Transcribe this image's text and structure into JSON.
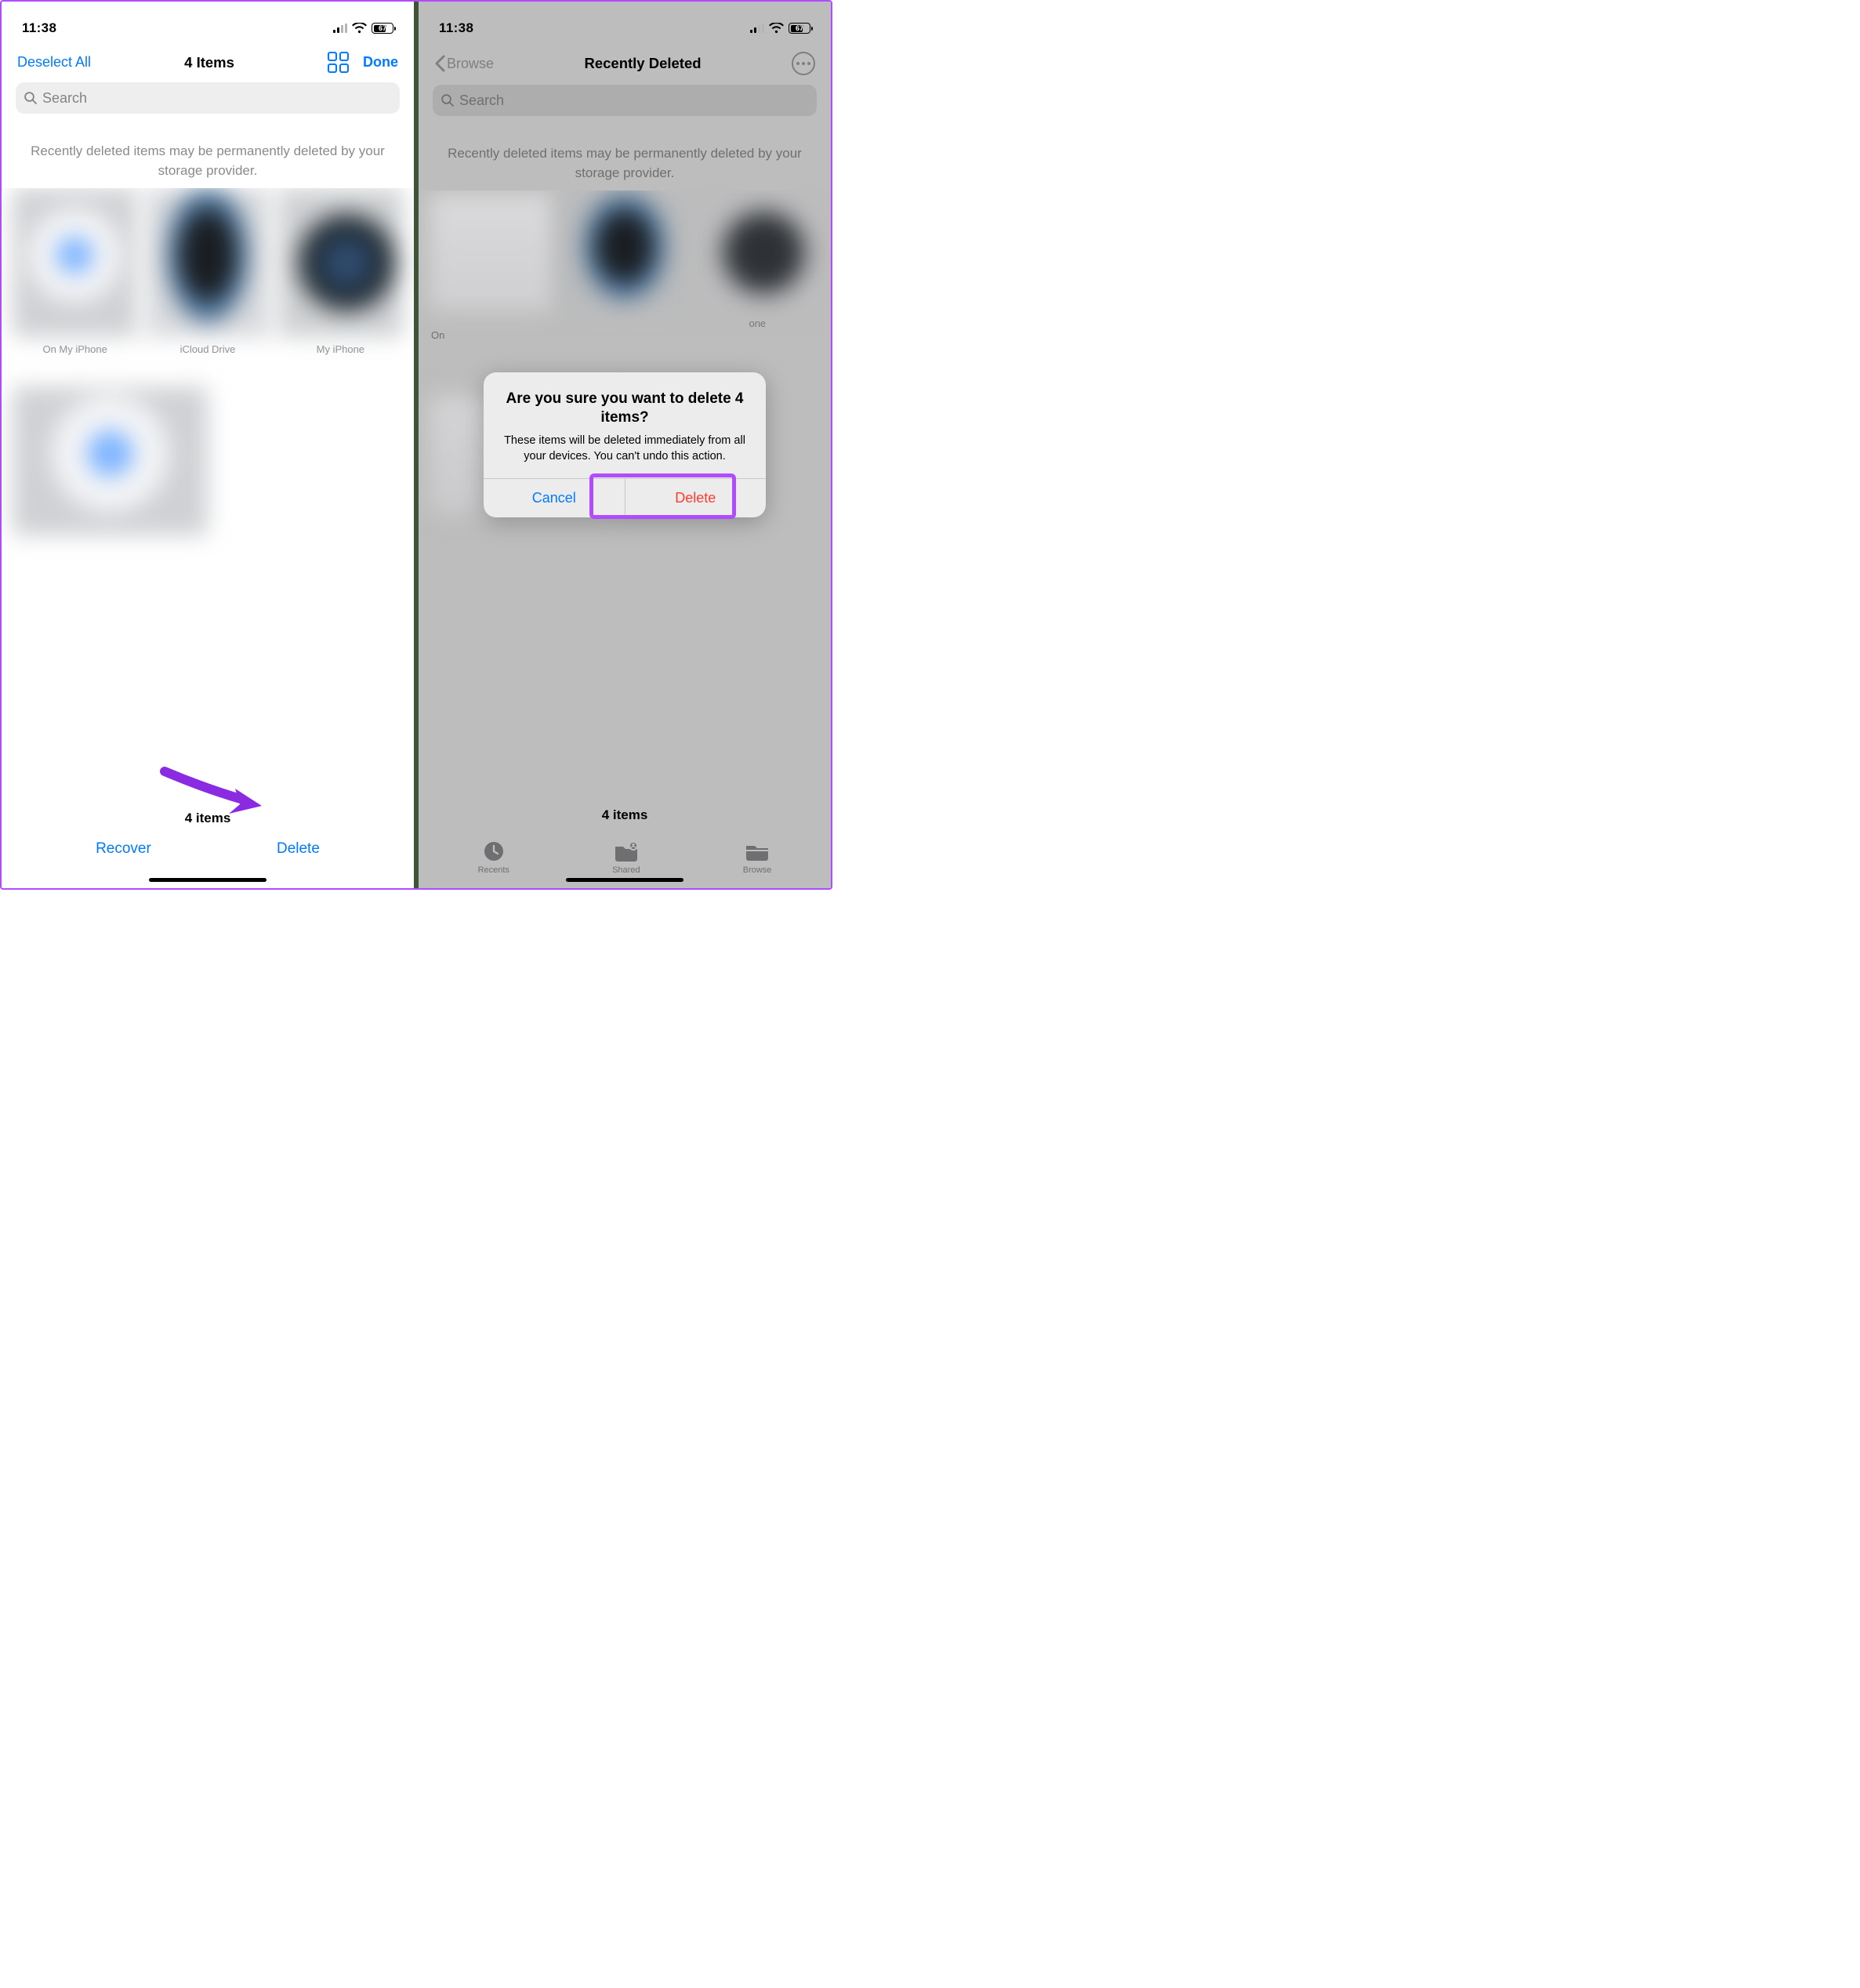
{
  "left": {
    "status": {
      "time": "11:38",
      "battery_pct": "67"
    },
    "nav": {
      "deselect": "Deselect All",
      "title": "4 Items",
      "done": "Done"
    },
    "search_placeholder": "Search",
    "info_text": "Recently deleted items may be permanently deleted by your storage provider.",
    "items": [
      {
        "caption": "On My iPhone"
      },
      {
        "caption": "iCloud Drive"
      },
      {
        "caption": "My iPhone"
      }
    ],
    "count": "4 items",
    "toolbar": {
      "recover": "Recover",
      "delete": "Delete"
    }
  },
  "right": {
    "status": {
      "time": "11:38",
      "battery_pct": "67"
    },
    "nav": {
      "back": "Browse",
      "title": "Recently Deleted"
    },
    "search_placeholder": "Search",
    "info_text": "Recently deleted items may be permanently deleted by your storage provider.",
    "loc_label": "On",
    "item_caption_suffix": "one",
    "count": "4 items",
    "tabs": {
      "recents": "Recents",
      "shared": "Shared",
      "browse": "Browse"
    },
    "alert": {
      "title": "Are you sure you want to delete 4 items?",
      "message": "These items will be deleted immediately from all your devices. You can't undo this action.",
      "cancel": "Cancel",
      "delete": "Delete"
    }
  }
}
